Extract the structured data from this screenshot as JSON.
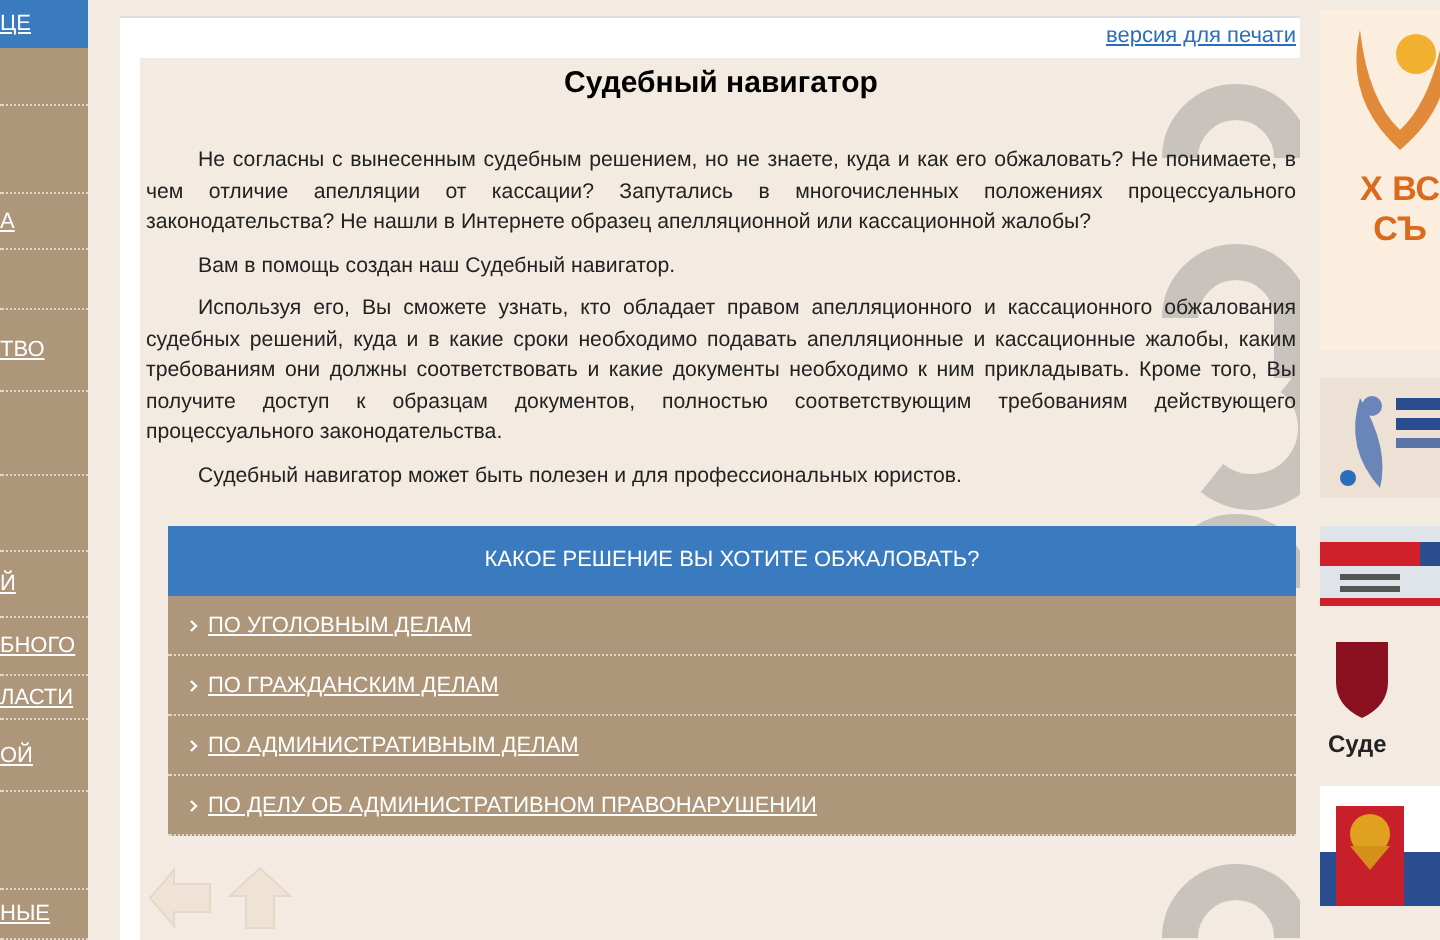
{
  "sidebar": {
    "items": [
      {
        "label": "ЦЕ",
        "selected": true
      },
      {
        "label": "А",
        "selected": false
      },
      {
        "label": "ТВО",
        "selected": false
      },
      {
        "label": "Й",
        "selected": false
      },
      {
        "label": "БНОГО",
        "selected": false
      },
      {
        "label": "ЛАСТИ",
        "selected": false
      },
      {
        "label": "ОЙ",
        "selected": false
      },
      {
        "label": "НЫЕ",
        "selected": false
      }
    ]
  },
  "article": {
    "print_link": "версия для печати",
    "title": "Судебный навигатор",
    "paragraphs": [
      "Не согласны с вынесенным судебным решением, но не знаете, куда и как его обжаловать? Не понимаете, в чем отличие апелляции от кассации? Запутались в многочисленных положениях процессуального законодательства? Не нашли в Интернете образец апелляционной или кассационной жалобы?",
      "Вам в помощь создан наш Судебный навигатор.",
      "Используя его, Вы сможете узнать, кто обладает правом апелляционного и кассационного обжалования судебных решений, куда и в какие сроки необходимо подавать апелляционные и кассационные жалобы, каким требованиям они должны соответствовать и какие документы необходимо к ним прикладывать. Кроме того, Вы получите доступ к образцам документов, полностью соответствующим требованиям действующего процессуального законодательства.",
      "Судебный навигатор может быть полезен и для профессиональных юристов."
    ],
    "navigator": {
      "heading": "КАКОЕ РЕШЕНИЕ ВЫ ХОТИТЕ ОБЖАЛОВАТЬ?",
      "items": [
        "ПО УГОЛОВНЫМ ДЕЛАМ",
        "ПО ГРАЖДАНСКИМ ДЕЛАМ",
        "ПО АДМИНИСТРАТИВНЫМ ДЕЛАМ",
        "ПО ДЕЛУ ОБ АДМИНИСТРАТИВНОМ ПРАВОНАРУШЕНИИ"
      ]
    }
  },
  "right_column": {
    "banner_lines": [
      "Х ВС",
      "СЪ"
    ],
    "caption": "Суде"
  }
}
